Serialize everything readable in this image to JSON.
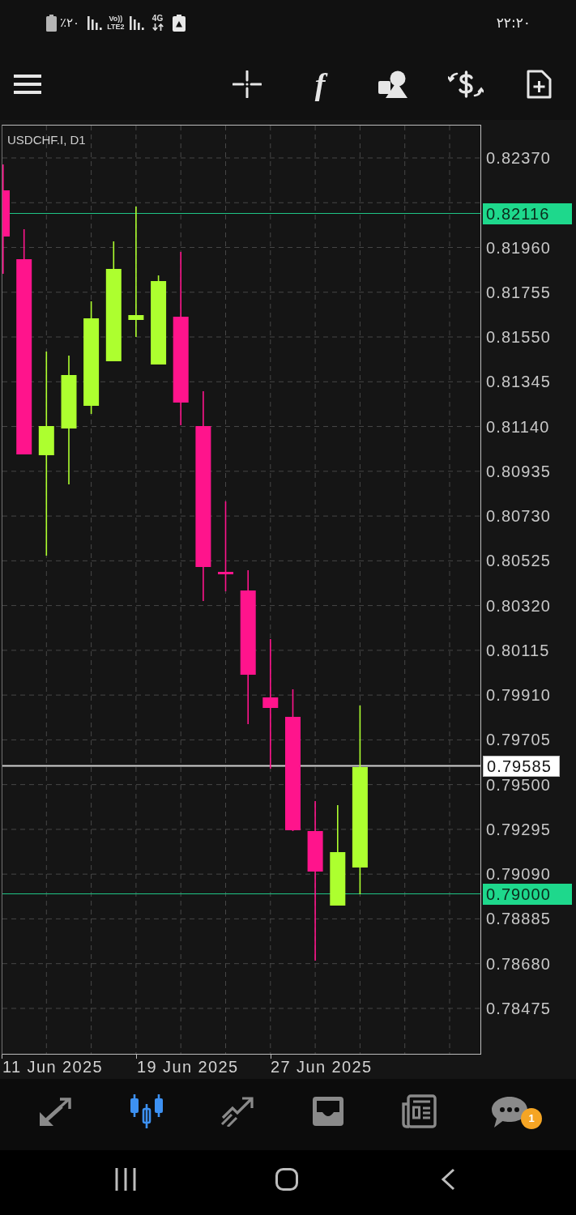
{
  "status_bar": {
    "battery_level": "٪۲۰",
    "volte": "Vo))",
    "network": "LTE2",
    "data_type": "4G",
    "time": "۲۲:۲۰"
  },
  "toolbar": {
    "function_glyph": "f"
  },
  "chart": {
    "symbol": "USDCHF.I, D1",
    "price_axis": [
      "0.82370",
      "0.81960",
      "0.81755",
      "0.81550",
      "0.81345",
      "0.81140",
      "0.80935",
      "0.80730",
      "0.80525",
      "0.80320",
      "0.80115",
      "0.79910",
      "0.79705",
      "0.79500",
      "0.79295",
      "0.79090",
      "0.78885",
      "0.78680",
      "0.78475"
    ],
    "price_lines": [
      {
        "kind": "level",
        "label": "0.82116"
      },
      {
        "kind": "bid",
        "label": "0.79585"
      },
      {
        "kind": "level",
        "label": "0.79000"
      }
    ],
    "dates": [
      "11 Jun 2025",
      "19 Jun 2025",
      "27 Jun 2025"
    ]
  },
  "bottom_nav": [
    {
      "kind": "arrows",
      "selected": false
    },
    {
      "kind": "candles",
      "selected": true
    },
    {
      "kind": "trend",
      "selected": false
    },
    {
      "kind": "tray",
      "selected": false
    },
    {
      "kind": "newspaper",
      "selected": false
    },
    {
      "kind": "chat",
      "selected": false,
      "badge": "1"
    }
  ]
}
